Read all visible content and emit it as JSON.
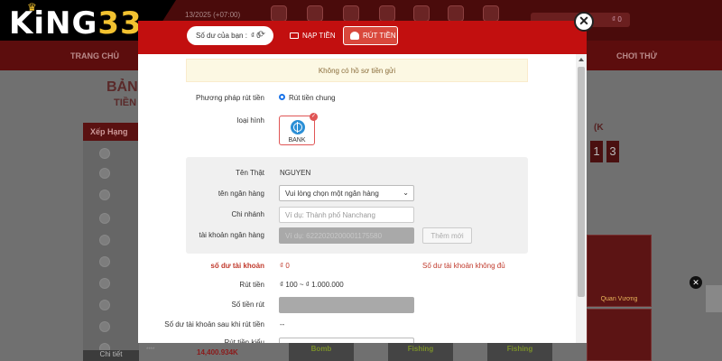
{
  "background": {
    "logo": {
      "text": "KiNG",
      "number": "33"
    },
    "date_text": "13/2025 (+07:00)",
    "account_text": "₫ 0",
    "nav": {
      "home": "TRANG CHỦ",
      "demo": "CHƠI THỬ"
    },
    "page_title": "BẢN",
    "page_subtitle": "TIỀN",
    "rank_header": "Xếp Hạng",
    "rank_footer": "Chi tiết",
    "winner_user": "****",
    "winner_amount": "14,400.934K",
    "jackpot_prefix": "(K",
    "jackpot_digits": [
      "1",
      "3"
    ],
    "game_labels": [
      "Quan Vương",
      ""
    ],
    "bottom_games": [
      "Bomb",
      "Fishing",
      "Fishing"
    ]
  },
  "modal": {
    "balance": {
      "label": "Số dư của bạn :",
      "amount": "₫ 0"
    },
    "tabs": {
      "deposit": "NẠP TIỀN",
      "withdraw": "RÚT TIỀN"
    },
    "close_symbol": "✕",
    "notice": "Không có hồ sơ tiền gửi",
    "method": {
      "label": "Phương pháp rút tiền",
      "value": "Rút tiền chung"
    },
    "type": {
      "label": "loại hình",
      "bank_label": "BANK"
    },
    "real_name": {
      "label": "Tên Thật",
      "value": "NGUYEN"
    },
    "bank_name": {
      "label": "tên ngân hàng",
      "value": "Vui lòng chọn một ngân hàng"
    },
    "branch": {
      "label": "Chi nhánh",
      "placeholder": "Ví dụ: Thành phố Nanchang"
    },
    "account_number": {
      "label": "tài khoản ngân hàng",
      "value": "Ví dụ: 6222020200001175580"
    },
    "add_button": "Thêm mới",
    "account_balance": {
      "label": "số dư tài khoản",
      "value": "₫ 0",
      "warning": "Số dư tài khoản không đủ"
    },
    "withdraw_range": {
      "label": "Rút tiền",
      "value": "₫ 100 ~ ₫ 1.000.000"
    },
    "withdraw_amount": {
      "label": "Số tiền rút"
    },
    "balance_after": {
      "label": "Số dư tài khoản sau khi rút tiền",
      "value": "--"
    },
    "withdraw_password": {
      "label": "Rút tiền kiểu"
    }
  }
}
